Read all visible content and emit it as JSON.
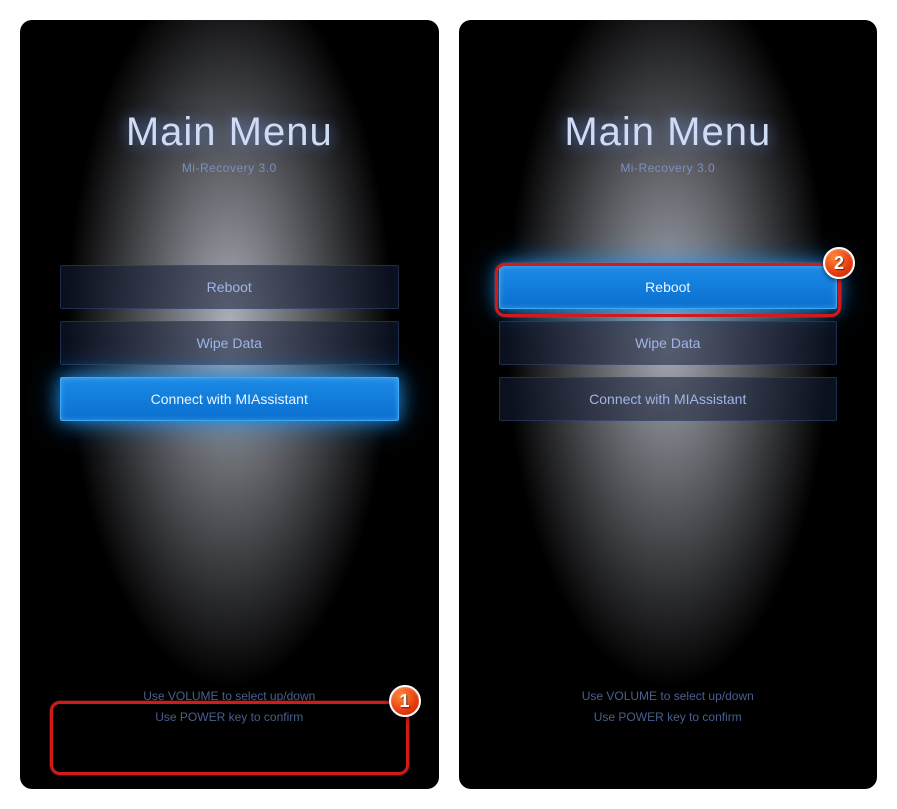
{
  "screens": [
    {
      "title": "Main Menu",
      "subtitle": "Mi-Recovery 3.0",
      "items": [
        {
          "label": "Reboot",
          "selected": false
        },
        {
          "label": "Wipe Data",
          "selected": false
        },
        {
          "label": "Connect with MIAssistant",
          "selected": true
        }
      ],
      "hint1": "Use VOLUME to select up/down",
      "hint2": "Use POWER key to confirm",
      "badge": "1"
    },
    {
      "title": "Main Menu",
      "subtitle": "Mi-Recovery 3.0",
      "items": [
        {
          "label": "Reboot",
          "selected": true
        },
        {
          "label": "Wipe Data",
          "selected": false
        },
        {
          "label": "Connect with MIAssistant",
          "selected": false
        }
      ],
      "hint1": "Use VOLUME to select up/down",
      "hint2": "Use POWER key to confirm",
      "badge": "2"
    }
  ]
}
